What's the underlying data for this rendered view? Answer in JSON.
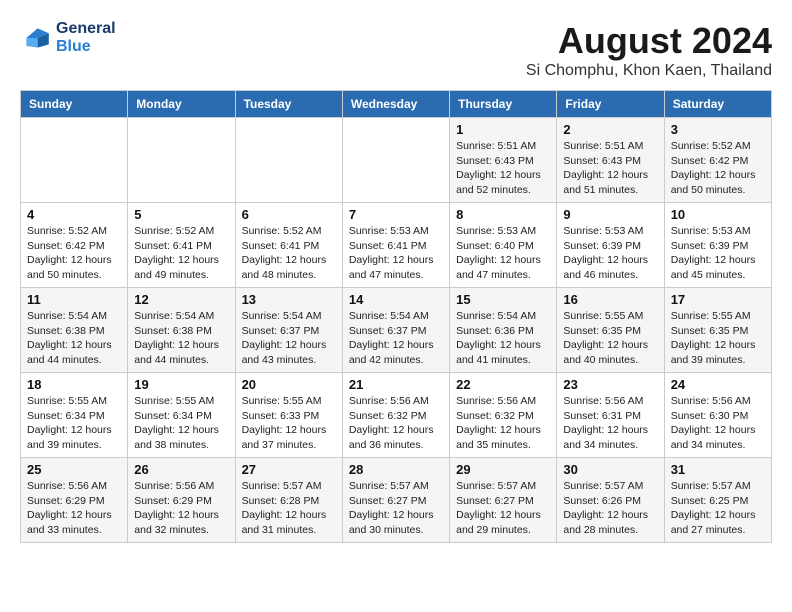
{
  "logo": {
    "line1": "General",
    "line2": "Blue"
  },
  "title": "August 2024",
  "subtitle": "Si Chomphu, Khon Kaen, Thailand",
  "days_of_week": [
    "Sunday",
    "Monday",
    "Tuesday",
    "Wednesday",
    "Thursday",
    "Friday",
    "Saturday"
  ],
  "weeks": [
    [
      {
        "day": "",
        "info": ""
      },
      {
        "day": "",
        "info": ""
      },
      {
        "day": "",
        "info": ""
      },
      {
        "day": "",
        "info": ""
      },
      {
        "day": "1",
        "info": "Sunrise: 5:51 AM\nSunset: 6:43 PM\nDaylight: 12 hours\nand 52 minutes."
      },
      {
        "day": "2",
        "info": "Sunrise: 5:51 AM\nSunset: 6:43 PM\nDaylight: 12 hours\nand 51 minutes."
      },
      {
        "day": "3",
        "info": "Sunrise: 5:52 AM\nSunset: 6:42 PM\nDaylight: 12 hours\nand 50 minutes."
      }
    ],
    [
      {
        "day": "4",
        "info": "Sunrise: 5:52 AM\nSunset: 6:42 PM\nDaylight: 12 hours\nand 50 minutes."
      },
      {
        "day": "5",
        "info": "Sunrise: 5:52 AM\nSunset: 6:41 PM\nDaylight: 12 hours\nand 49 minutes."
      },
      {
        "day": "6",
        "info": "Sunrise: 5:52 AM\nSunset: 6:41 PM\nDaylight: 12 hours\nand 48 minutes."
      },
      {
        "day": "7",
        "info": "Sunrise: 5:53 AM\nSunset: 6:41 PM\nDaylight: 12 hours\nand 47 minutes."
      },
      {
        "day": "8",
        "info": "Sunrise: 5:53 AM\nSunset: 6:40 PM\nDaylight: 12 hours\nand 47 minutes."
      },
      {
        "day": "9",
        "info": "Sunrise: 5:53 AM\nSunset: 6:39 PM\nDaylight: 12 hours\nand 46 minutes."
      },
      {
        "day": "10",
        "info": "Sunrise: 5:53 AM\nSunset: 6:39 PM\nDaylight: 12 hours\nand 45 minutes."
      }
    ],
    [
      {
        "day": "11",
        "info": "Sunrise: 5:54 AM\nSunset: 6:38 PM\nDaylight: 12 hours\nand 44 minutes."
      },
      {
        "day": "12",
        "info": "Sunrise: 5:54 AM\nSunset: 6:38 PM\nDaylight: 12 hours\nand 44 minutes."
      },
      {
        "day": "13",
        "info": "Sunrise: 5:54 AM\nSunset: 6:37 PM\nDaylight: 12 hours\nand 43 minutes."
      },
      {
        "day": "14",
        "info": "Sunrise: 5:54 AM\nSunset: 6:37 PM\nDaylight: 12 hours\nand 42 minutes."
      },
      {
        "day": "15",
        "info": "Sunrise: 5:54 AM\nSunset: 6:36 PM\nDaylight: 12 hours\nand 41 minutes."
      },
      {
        "day": "16",
        "info": "Sunrise: 5:55 AM\nSunset: 6:35 PM\nDaylight: 12 hours\nand 40 minutes."
      },
      {
        "day": "17",
        "info": "Sunrise: 5:55 AM\nSunset: 6:35 PM\nDaylight: 12 hours\nand 39 minutes."
      }
    ],
    [
      {
        "day": "18",
        "info": "Sunrise: 5:55 AM\nSunset: 6:34 PM\nDaylight: 12 hours\nand 39 minutes."
      },
      {
        "day": "19",
        "info": "Sunrise: 5:55 AM\nSunset: 6:34 PM\nDaylight: 12 hours\nand 38 minutes."
      },
      {
        "day": "20",
        "info": "Sunrise: 5:55 AM\nSunset: 6:33 PM\nDaylight: 12 hours\nand 37 minutes."
      },
      {
        "day": "21",
        "info": "Sunrise: 5:56 AM\nSunset: 6:32 PM\nDaylight: 12 hours\nand 36 minutes."
      },
      {
        "day": "22",
        "info": "Sunrise: 5:56 AM\nSunset: 6:32 PM\nDaylight: 12 hours\nand 35 minutes."
      },
      {
        "day": "23",
        "info": "Sunrise: 5:56 AM\nSunset: 6:31 PM\nDaylight: 12 hours\nand 34 minutes."
      },
      {
        "day": "24",
        "info": "Sunrise: 5:56 AM\nSunset: 6:30 PM\nDaylight: 12 hours\nand 34 minutes."
      }
    ],
    [
      {
        "day": "25",
        "info": "Sunrise: 5:56 AM\nSunset: 6:29 PM\nDaylight: 12 hours\nand 33 minutes."
      },
      {
        "day": "26",
        "info": "Sunrise: 5:56 AM\nSunset: 6:29 PM\nDaylight: 12 hours\nand 32 minutes."
      },
      {
        "day": "27",
        "info": "Sunrise: 5:57 AM\nSunset: 6:28 PM\nDaylight: 12 hours\nand 31 minutes."
      },
      {
        "day": "28",
        "info": "Sunrise: 5:57 AM\nSunset: 6:27 PM\nDaylight: 12 hours\nand 30 minutes."
      },
      {
        "day": "29",
        "info": "Sunrise: 5:57 AM\nSunset: 6:27 PM\nDaylight: 12 hours\nand 29 minutes."
      },
      {
        "day": "30",
        "info": "Sunrise: 5:57 AM\nSunset: 6:26 PM\nDaylight: 12 hours\nand 28 minutes."
      },
      {
        "day": "31",
        "info": "Sunrise: 5:57 AM\nSunset: 6:25 PM\nDaylight: 12 hours\nand 27 minutes."
      }
    ]
  ]
}
